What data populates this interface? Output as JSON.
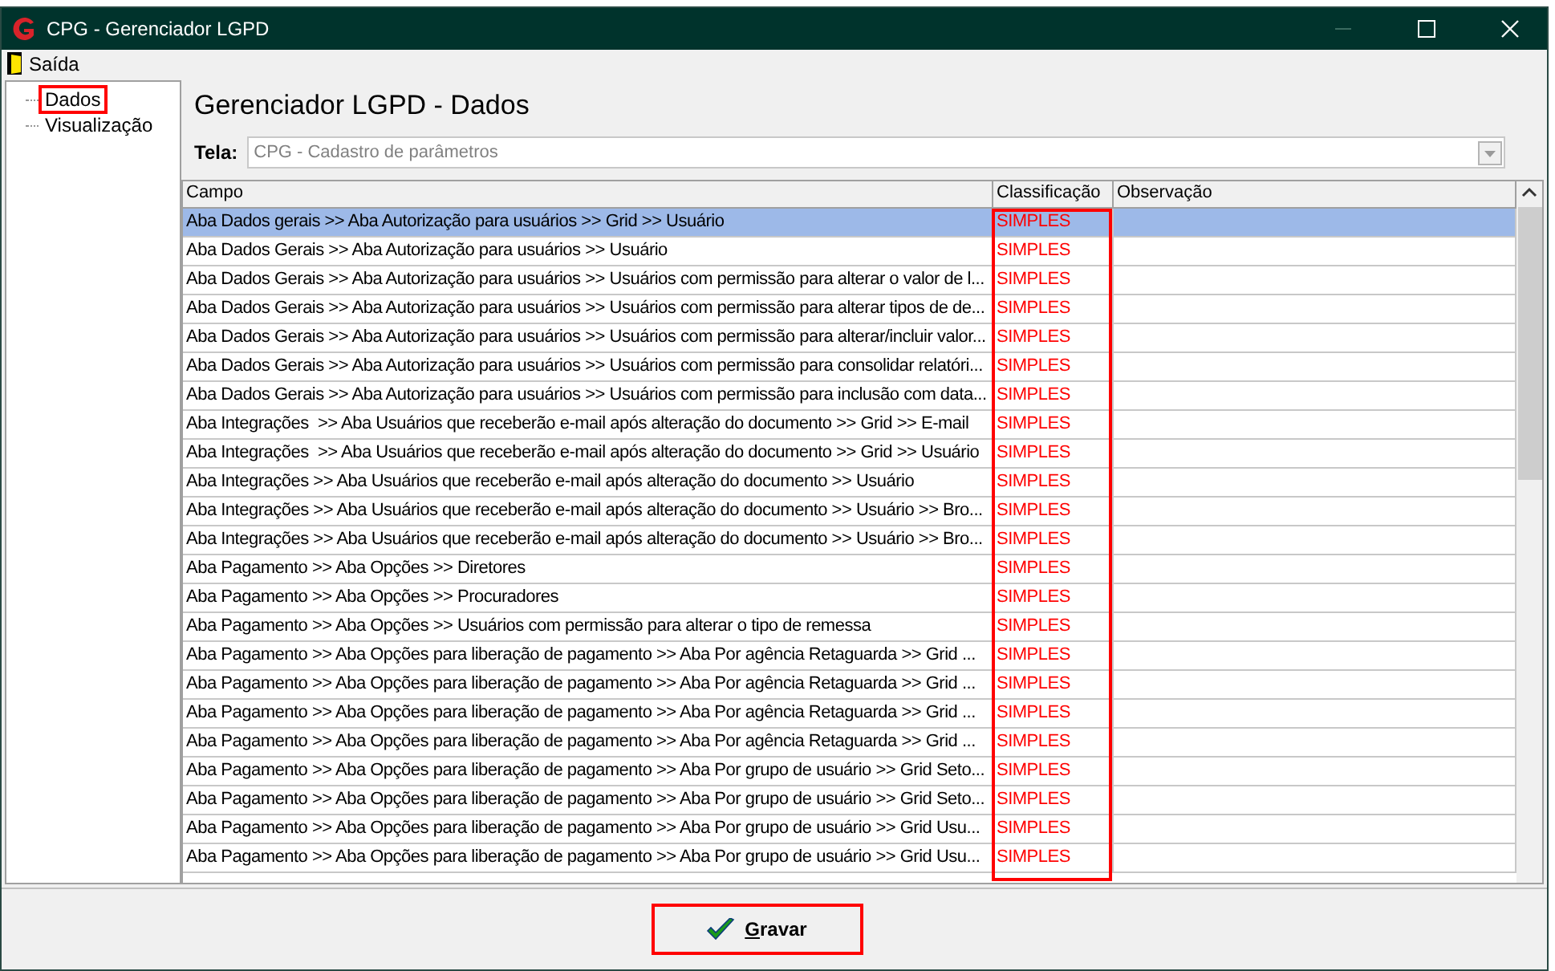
{
  "window": {
    "title": "CPG - Gerenciador LGPD"
  },
  "menu": [
    "Saída"
  ],
  "tree": [
    {
      "label": "Dados",
      "highlighted": true
    },
    {
      "label": "Visualização",
      "highlighted": false
    }
  ],
  "heading": "Gerenciador LGPD - Dados",
  "tela": {
    "label": "Tela:",
    "value": "CPG - Cadastro de parâmetros"
  },
  "table": {
    "columns": [
      "Campo",
      "Classificação",
      "Observação"
    ],
    "classification_highlighted": true,
    "rows": [
      {
        "campo": "Aba Dados gerais >> Aba Autorização para usuários >> Grid >> Usuário",
        "classificacao": "SIMPLES",
        "selected": true
      },
      {
        "campo": "Aba Dados Gerais >> Aba Autorização para usuários >> Usuário",
        "classificacao": "SIMPLES",
        "selected": false
      },
      {
        "campo": "Aba Dados Gerais >> Aba Autorização para usuários >> Usuários com permissão para alterar o valor de l...",
        "classificacao": "SIMPLES",
        "selected": false
      },
      {
        "campo": "Aba Dados Gerais >> Aba Autorização para usuários >> Usuários com permissão para alterar tipos de de...",
        "classificacao": "SIMPLES",
        "selected": false
      },
      {
        "campo": "Aba Dados Gerais >> Aba Autorização para usuários >> Usuários com permissão para alterar/incluir valor...",
        "classificacao": "SIMPLES",
        "selected": false
      },
      {
        "campo": "Aba Dados Gerais >> Aba Autorização para usuários >> Usuários com permissão para consolidar relatóri...",
        "classificacao": "SIMPLES",
        "selected": false
      },
      {
        "campo": "Aba Dados Gerais >> Aba Autorização para usuários >> Usuários com permissão para inclusão com data...",
        "classificacao": "SIMPLES",
        "selected": false
      },
      {
        "campo": "Aba Integrações  >> Aba Usuários que receberão e-mail após alteração do documento >> Grid >> E-mail",
        "classificacao": "SIMPLES",
        "selected": false
      },
      {
        "campo": "Aba Integrações  >> Aba Usuários que receberão e-mail após alteração do documento >> Grid >> Usuário",
        "classificacao": "SIMPLES",
        "selected": false
      },
      {
        "campo": "Aba Integrações >> Aba Usuários que receberão e-mail após alteração do documento >> Usuário",
        "classificacao": "SIMPLES",
        "selected": false
      },
      {
        "campo": "Aba Integrações >> Aba Usuários que receberão e-mail após alteração do documento >> Usuário >> Bro...",
        "classificacao": "SIMPLES",
        "selected": false
      },
      {
        "campo": "Aba Integrações >> Aba Usuários que receberão e-mail após alteração do documento >> Usuário >> Bro...",
        "classificacao": "SIMPLES",
        "selected": false
      },
      {
        "campo": "Aba Pagamento >> Aba Opções >> Diretores",
        "classificacao": "SIMPLES",
        "selected": false
      },
      {
        "campo": "Aba Pagamento >> Aba Opções >> Procuradores",
        "classificacao": "SIMPLES",
        "selected": false
      },
      {
        "campo": "Aba Pagamento >> Aba Opções >> Usuários com permissão para alterar o tipo de remessa",
        "classificacao": "SIMPLES",
        "selected": false
      },
      {
        "campo": "Aba Pagamento >> Aba Opções para liberação de pagamento >> Aba Por agência Retaguarda >> Grid ...",
        "classificacao": "SIMPLES",
        "selected": false
      },
      {
        "campo": "Aba Pagamento >> Aba Opções para liberação de pagamento >> Aba Por agência Retaguarda >> Grid ...",
        "classificacao": "SIMPLES",
        "selected": false
      },
      {
        "campo": "Aba Pagamento >> Aba Opções para liberação de pagamento >> Aba Por agência Retaguarda >> Grid ...",
        "classificacao": "SIMPLES",
        "selected": false
      },
      {
        "campo": "Aba Pagamento >> Aba Opções para liberação de pagamento >> Aba Por agência Retaguarda >> Grid ...",
        "classificacao": "SIMPLES",
        "selected": false
      },
      {
        "campo": "Aba Pagamento >> Aba Opções para liberação de pagamento >> Aba Por grupo de usuário >> Grid Seto...",
        "classificacao": "SIMPLES",
        "selected": false
      },
      {
        "campo": "Aba Pagamento >> Aba Opções para liberação de pagamento >> Aba Por grupo de usuário >> Grid Seto...",
        "classificacao": "SIMPLES",
        "selected": false
      },
      {
        "campo": "Aba Pagamento >> Aba Opções para liberação de pagamento >> Aba Por grupo de usuário >> Grid Usu...",
        "classificacao": "SIMPLES",
        "selected": false
      },
      {
        "campo": "Aba Pagamento >> Aba Opções para liberação de pagamento >> Aba Por grupo de usuário >> Grid Usu...",
        "classificacao": "SIMPLES",
        "selected": false
      }
    ]
  },
  "save_button": {
    "label": "Gravar",
    "highlighted": true
  }
}
